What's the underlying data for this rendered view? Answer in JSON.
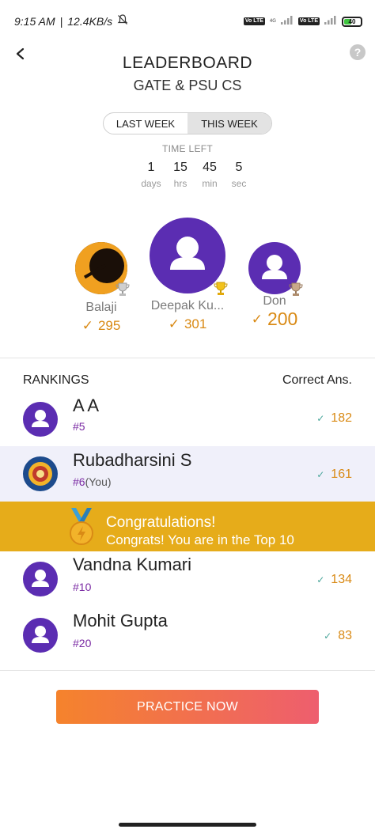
{
  "status_bar": {
    "time": "9:15 AM",
    "speed": "12.4KB/s",
    "volte1": "Vo LTE",
    "net_label": "4G",
    "volte2": "Vo LTE",
    "battery": "40",
    "battery_level": 0.4
  },
  "header": {
    "title": "LEADERBOARD",
    "subtitle": "GATE & PSU CS",
    "help": "?"
  },
  "toggle": {
    "options": [
      "LAST WEEK",
      "THIS WEEK"
    ],
    "selected": "THIS WEEK"
  },
  "countdown": {
    "label": "TIME LEFT",
    "units": [
      {
        "value": "1",
        "label": "days"
      },
      {
        "value": "15",
        "label": "hrs"
      },
      {
        "value": "45",
        "label": "min"
      },
      {
        "value": "5",
        "label": "sec"
      }
    ]
  },
  "podium": {
    "first": {
      "name": "Deepak Ku...",
      "score": "301",
      "trophy": "gold-trophy-icon"
    },
    "second": {
      "name": "Balaji",
      "score": "295",
      "trophy": "silver-trophy-icon"
    },
    "third": {
      "name": "Don",
      "score": "200",
      "trophy": "bronze-trophy-icon"
    }
  },
  "rankings": {
    "header_left": "RANKINGS",
    "header_right": "Correct Ans.",
    "rows": [
      {
        "name": "A A",
        "rank": "#5",
        "you": "",
        "score": "182"
      },
      {
        "name": "Rubadharsini S",
        "rank": "#6",
        "you": "(You)",
        "score": "161"
      },
      {
        "name": "Vandna Kumari",
        "rank": "#10",
        "you": "",
        "score": "134"
      },
      {
        "name": "Mohit Gupta",
        "rank": "#20",
        "you": "",
        "score": "83"
      }
    ]
  },
  "congrats": {
    "title": "Congratulations!",
    "subtitle": "Congrats! You are in the Top 10"
  },
  "cta": {
    "label": "PRACTICE NOW"
  },
  "colors": {
    "brand_purple": "#5b2db2",
    "score_orange": "#d98a15",
    "banner_gold": "#e6ac1a"
  }
}
